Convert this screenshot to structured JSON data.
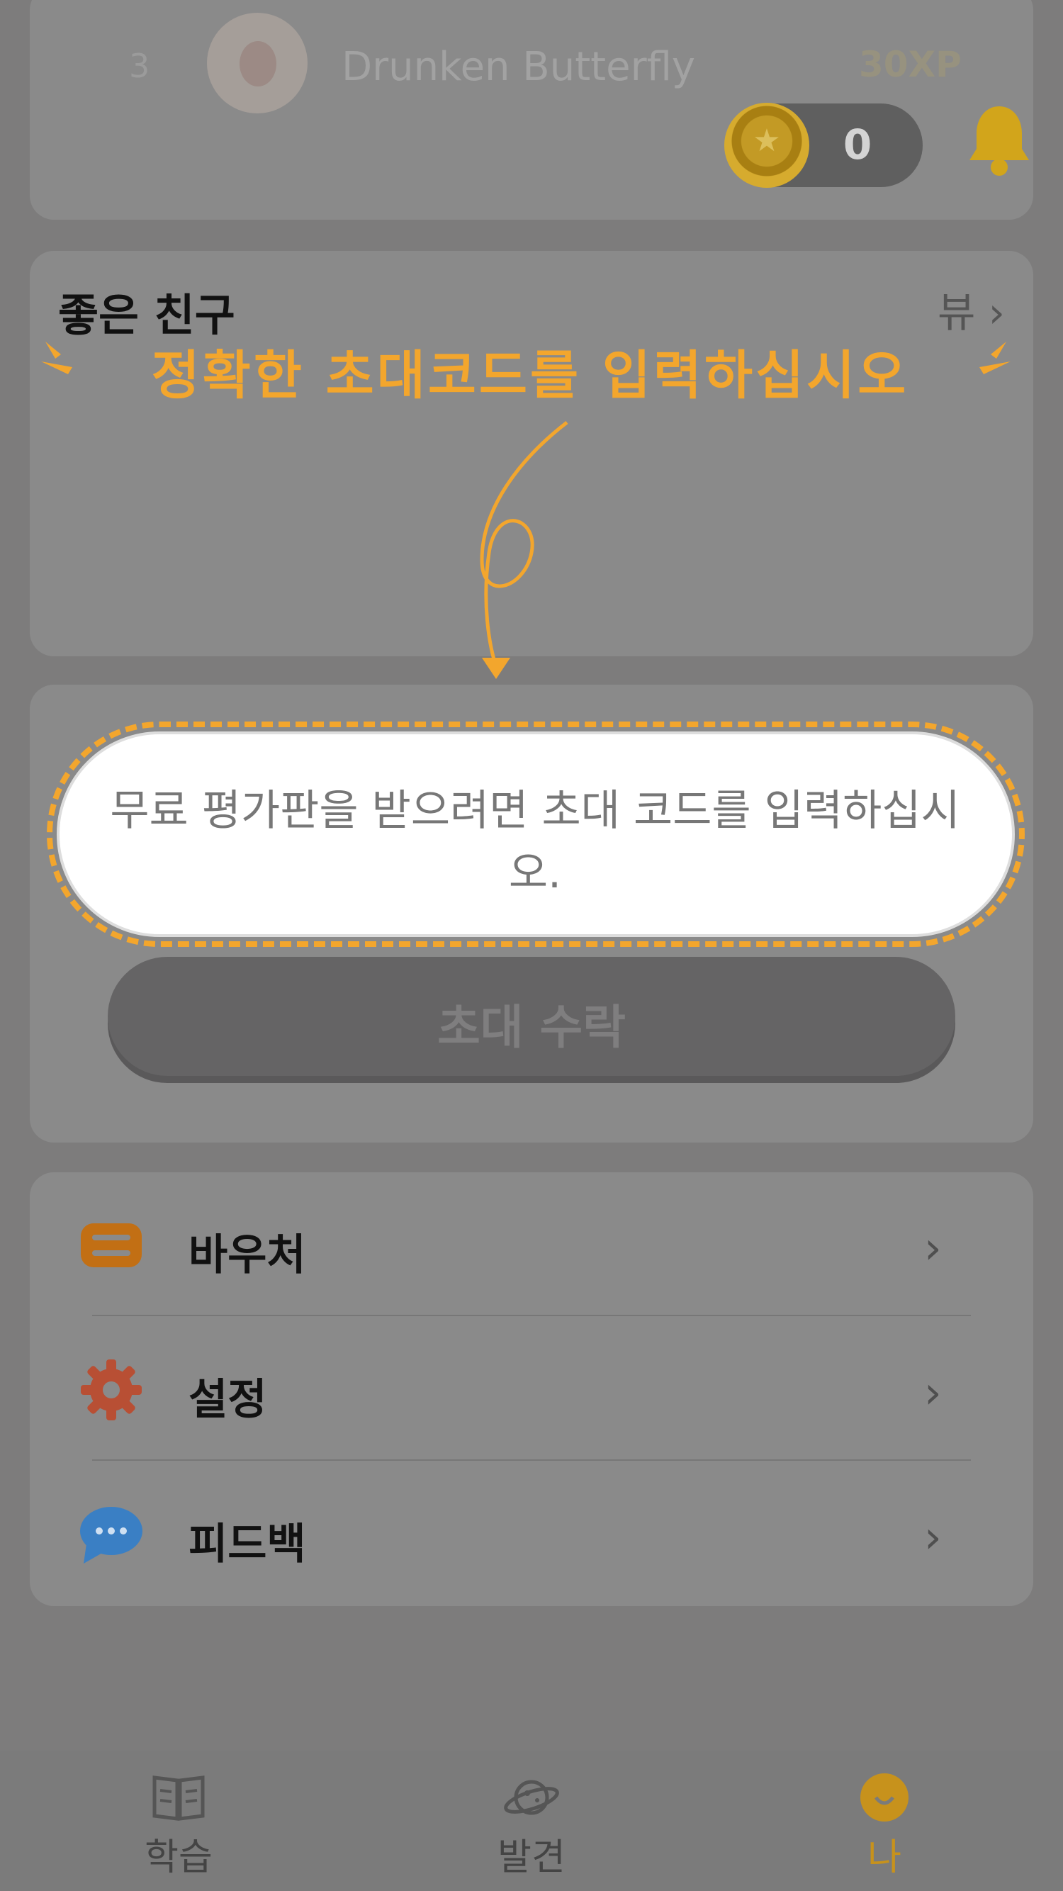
{
  "profile": {
    "rank": "3",
    "username": "Drunken Butterfly",
    "points": "30XP",
    "coins": "0",
    "coin_icon": "coin-icon",
    "notification_icon": "bell-icon"
  },
  "friends": {
    "title": "좋은 친구",
    "view_label": "뷰"
  },
  "annotation": {
    "text": "정확한 초대코드를 입력하십시오",
    "color": "#f3a62d"
  },
  "invite": {
    "placeholder": "무료 평가판을 받으려면 초대 코드를 입력하십시오.",
    "accept_label": "초대 수락"
  },
  "menu": {
    "items": [
      {
        "label": "바우처",
        "icon": "voucher-icon"
      },
      {
        "label": "설정",
        "icon": "gear-icon"
      },
      {
        "label": "피드백",
        "icon": "chat-bubble-icon"
      }
    ]
  },
  "bottom_nav": {
    "items": [
      {
        "label": "학습",
        "icon": "book-icon"
      },
      {
        "label": "발견",
        "icon": "planet-icon"
      },
      {
        "label": "나",
        "icon": "face-icon",
        "active": true
      }
    ]
  }
}
